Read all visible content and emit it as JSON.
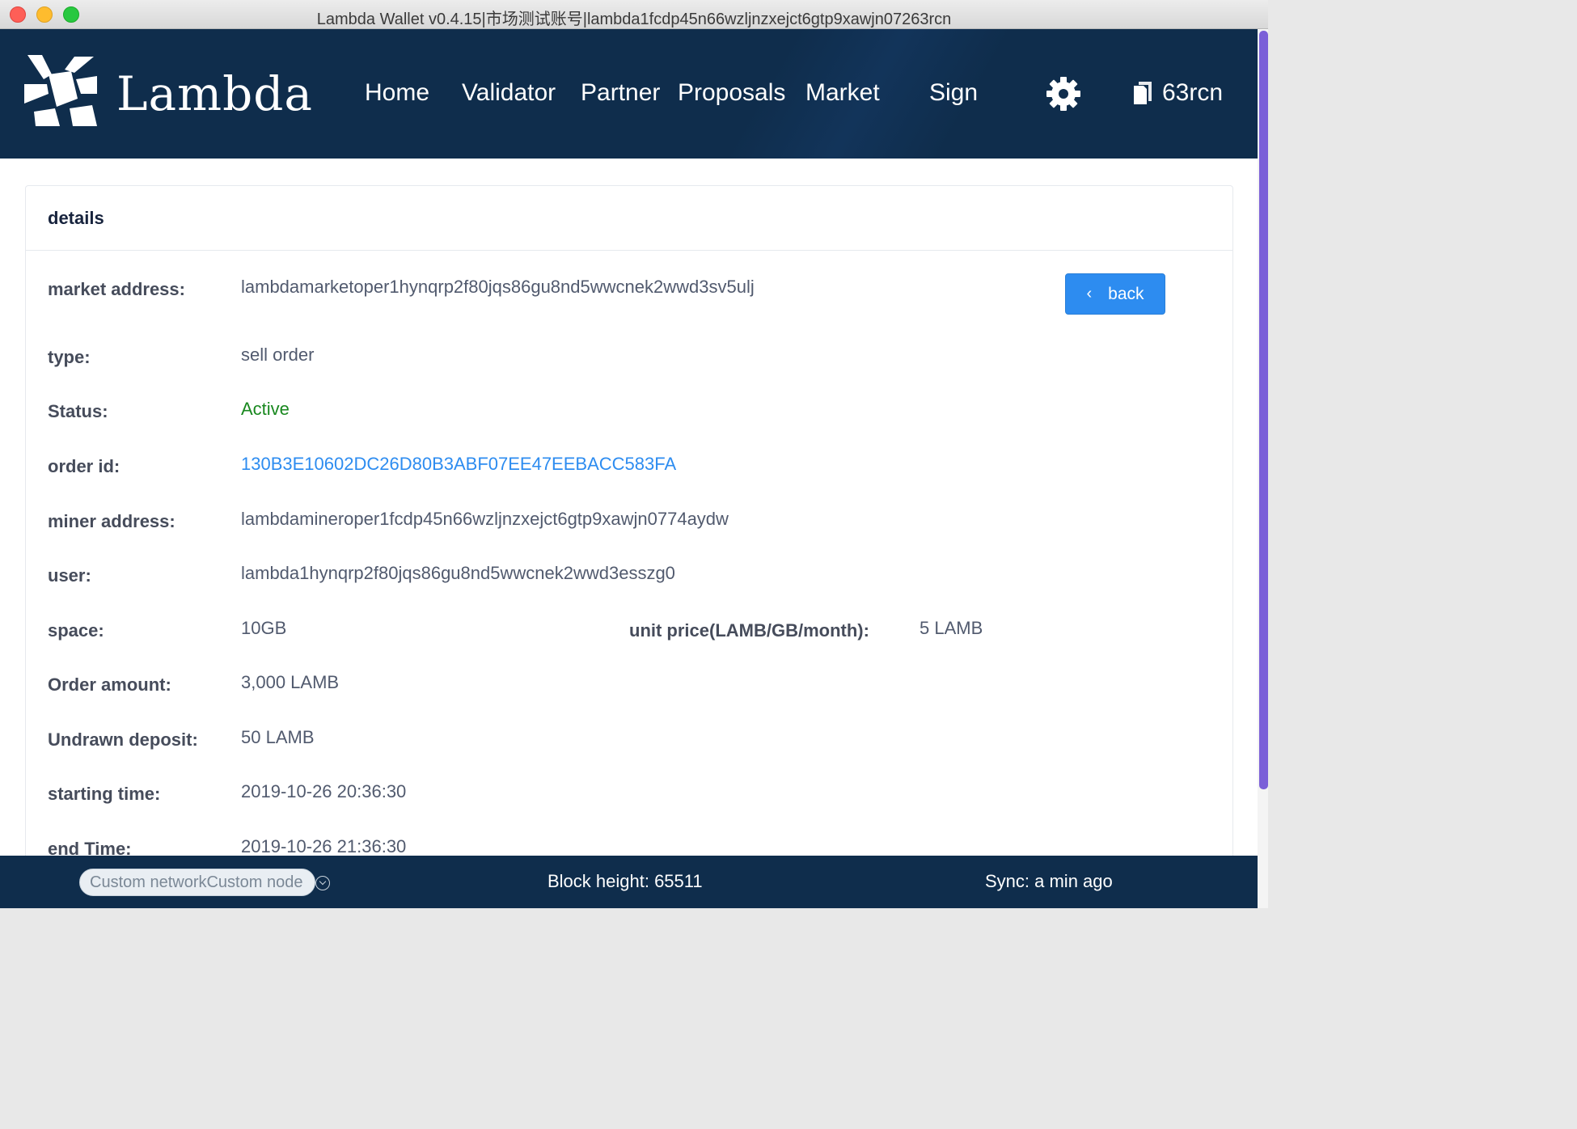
{
  "window": {
    "title": "Lambda Wallet v0.4.15|市场测试账号|lambda1fcdp45n66wzljnzxejct6gtp9xawjn07263rcn"
  },
  "header": {
    "brand": "Lambda",
    "nav": [
      "Home",
      "Validator",
      "Partner",
      "Proposals",
      "Market",
      "Sign"
    ],
    "account_label": "63rcn"
  },
  "details": {
    "title": "details",
    "back_label": "back",
    "rows": {
      "market_address": {
        "label": "market address:",
        "value": "lambdamarketoper1hynqrp2f80jqs86gu8nd5wwcnek2wwd3sv5ulj"
      },
      "type": {
        "label": "type:",
        "value": "sell order"
      },
      "status": {
        "label": "Status:",
        "value": "Active"
      },
      "order_id": {
        "label": "order id:",
        "value": "130B3E10602DC26D80B3ABF07EE47EEBACC583FA"
      },
      "miner_address": {
        "label": "miner address:",
        "value": "lambdamineroper1fcdp45n66wzljnzxejct6gtp9xawjn0774aydw"
      },
      "user": {
        "label": "user:",
        "value": "lambda1hynqrp2f80jqs86gu8nd5wwcnek2wwd3esszg0"
      },
      "space": {
        "label": "space:",
        "value": "10GB"
      },
      "unit_price": {
        "label": "unit price(LAMB/GB/month):",
        "value": "5 LAMB"
      },
      "order_amount": {
        "label": "Order amount:",
        "value": "3,000 LAMB"
      },
      "undrawn_deposit": {
        "label": "Undrawn deposit:",
        "value": "50 LAMB"
      },
      "starting_time": {
        "label": "starting time:",
        "value": "2019-10-26 20:36:30"
      },
      "end_time": {
        "label": "end Time:",
        "value": "2019-10-26 21:36:30"
      }
    }
  },
  "footer": {
    "network_select": "Custom networkCustom node",
    "block_height": "Block height: 65511",
    "sync": "Sync: a min ago"
  },
  "colors": {
    "header_bg": "#0f2d4c",
    "accent": "#2d8cf0",
    "active": "#19881f"
  },
  "icons": [
    "lambda-logo-icon",
    "gear-icon",
    "document-icon",
    "chevron-left-icon",
    "chevron-down-icon"
  ]
}
